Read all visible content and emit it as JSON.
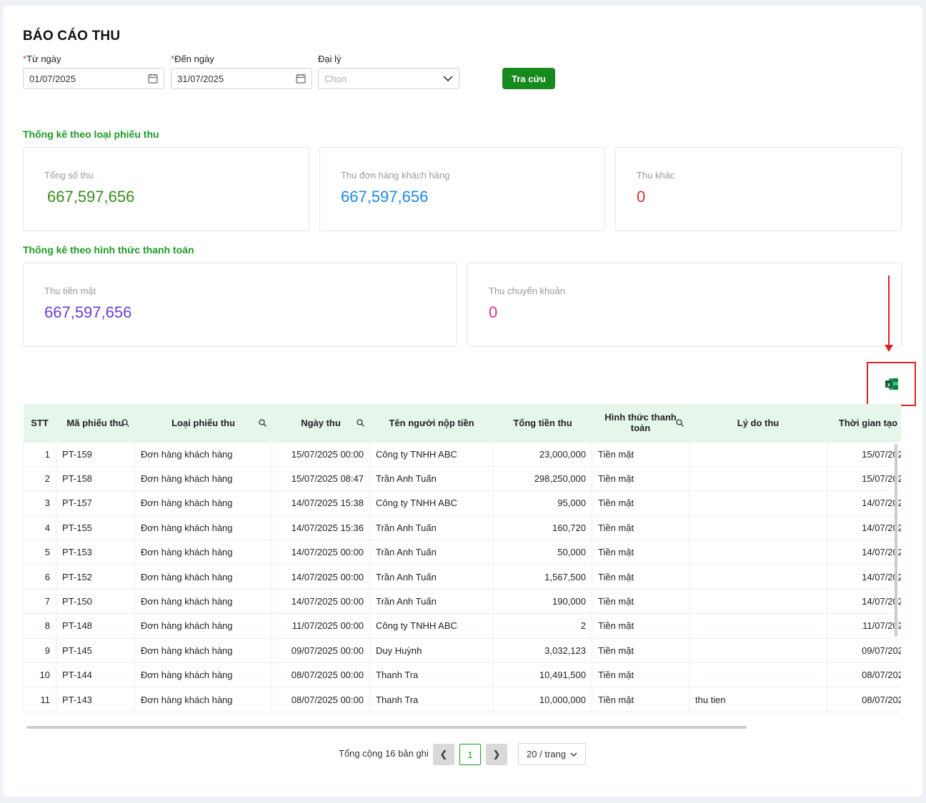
{
  "page": {
    "title": "BÁO CÁO THU"
  },
  "filters": {
    "from_label": "Từ ngày",
    "from_value": "01/07/2025",
    "to_label": "Đến ngày",
    "to_value": "31/07/2025",
    "agent_label": "Đại lý",
    "agent_placeholder": "Chọn",
    "required_mark": "*",
    "search_button": "Tra cứu"
  },
  "stats_by_type": {
    "title": "Thống kê theo loại phiếu thu",
    "cards": [
      {
        "label": "Tổng số thu",
        "value": "667,597,656",
        "color": "#3a8c1a"
      },
      {
        "label": "Thu đơn hàng khách hàng",
        "value": "667,597,656",
        "color": "#1e88e5"
      },
      {
        "label": "Thu khác",
        "value": "0",
        "color": "#d32f2f"
      }
    ]
  },
  "stats_by_payment": {
    "title": "Thống kê theo hình thức thanh toán",
    "cards": [
      {
        "label": "Thu tiền mặt",
        "value": "667,597,656",
        "color": "#6a3fd0"
      },
      {
        "label": "Thu chuyển khoản",
        "value": "0",
        "color": "#d63384"
      }
    ]
  },
  "export": {
    "icon": "excel-icon"
  },
  "table": {
    "columns": [
      "STT",
      "Mã phiếu thu",
      "Loại phiếu thu",
      "Ngày thu",
      "Tên người nộp tiền",
      "Tổng tiền thu",
      "Hình thức thanh toán",
      "Lý do thu",
      "Thời gian tạo"
    ],
    "rows": [
      [
        "1",
        "PT-159",
        "Đơn hàng khách hàng",
        "15/07/2025 00:00",
        "Công ty TNHH ABC",
        "23,000,000",
        "Tiền mặt",
        "",
        "15/07/202"
      ],
      [
        "2",
        "PT-158",
        "Đơn hàng khách hàng",
        "15/07/2025 08:47",
        "Trần Anh Tuấn",
        "298,250,000",
        "Tiền mặt",
        "",
        "15/07/202"
      ],
      [
        "3",
        "PT-157",
        "Đơn hàng khách hàng",
        "14/07/2025 15:38",
        "Công ty TNHH ABC",
        "95,000",
        "Tiền mặt",
        "",
        "14/07/202"
      ],
      [
        "4",
        "PT-155",
        "Đơn hàng khách hàng",
        "14/07/2025 15:36",
        "Trần Anh Tuấn",
        "160,720",
        "Tiền mặt",
        "",
        "14/07/202"
      ],
      [
        "5",
        "PT-153",
        "Đơn hàng khách hàng",
        "14/07/2025 00:00",
        "Trần Anh Tuấn",
        "50,000",
        "Tiền mặt",
        "",
        "14/07/202"
      ],
      [
        "6",
        "PT-152",
        "Đơn hàng khách hàng",
        "14/07/2025 00:00",
        "Trần Anh Tuấn",
        "1,567,500",
        "Tiền mặt",
        "",
        "14/07/202"
      ],
      [
        "7",
        "PT-150",
        "Đơn hàng khách hàng",
        "14/07/2025 00:00",
        "Trần Anh Tuấn",
        "190,000",
        "Tiền mặt",
        "",
        "14/07/202"
      ],
      [
        "8",
        "PT-148",
        "Đơn hàng khách hàng",
        "11/07/2025 00:00",
        "Công ty TNHH ABC",
        "2",
        "Tiền mặt",
        "",
        "11/07/202"
      ],
      [
        "9",
        "PT-145",
        "Đơn hàng khách hàng",
        "09/07/2025 00:00",
        "Duy Huỳnh",
        "3,032,123",
        "Tiền mặt",
        "",
        "09/07/202"
      ],
      [
        "10",
        "PT-144",
        "Đơn hàng khách hàng",
        "08/07/2025 00:00",
        "Thanh Tra",
        "10,491,500",
        "Tiền mặt",
        "",
        "08/07/202"
      ],
      [
        "11",
        "PT-143",
        "Đơn hàng khách hàng",
        "08/07/2025 00:00",
        "Thanh Tra",
        "10,000,000",
        "Tiền mặt",
        "thu tien",
        "08/07/202"
      ]
    ]
  },
  "pagination": {
    "total_text": "Tổng cộng 16 bản ghi",
    "current_page": "1",
    "page_size": "20 / trang"
  }
}
